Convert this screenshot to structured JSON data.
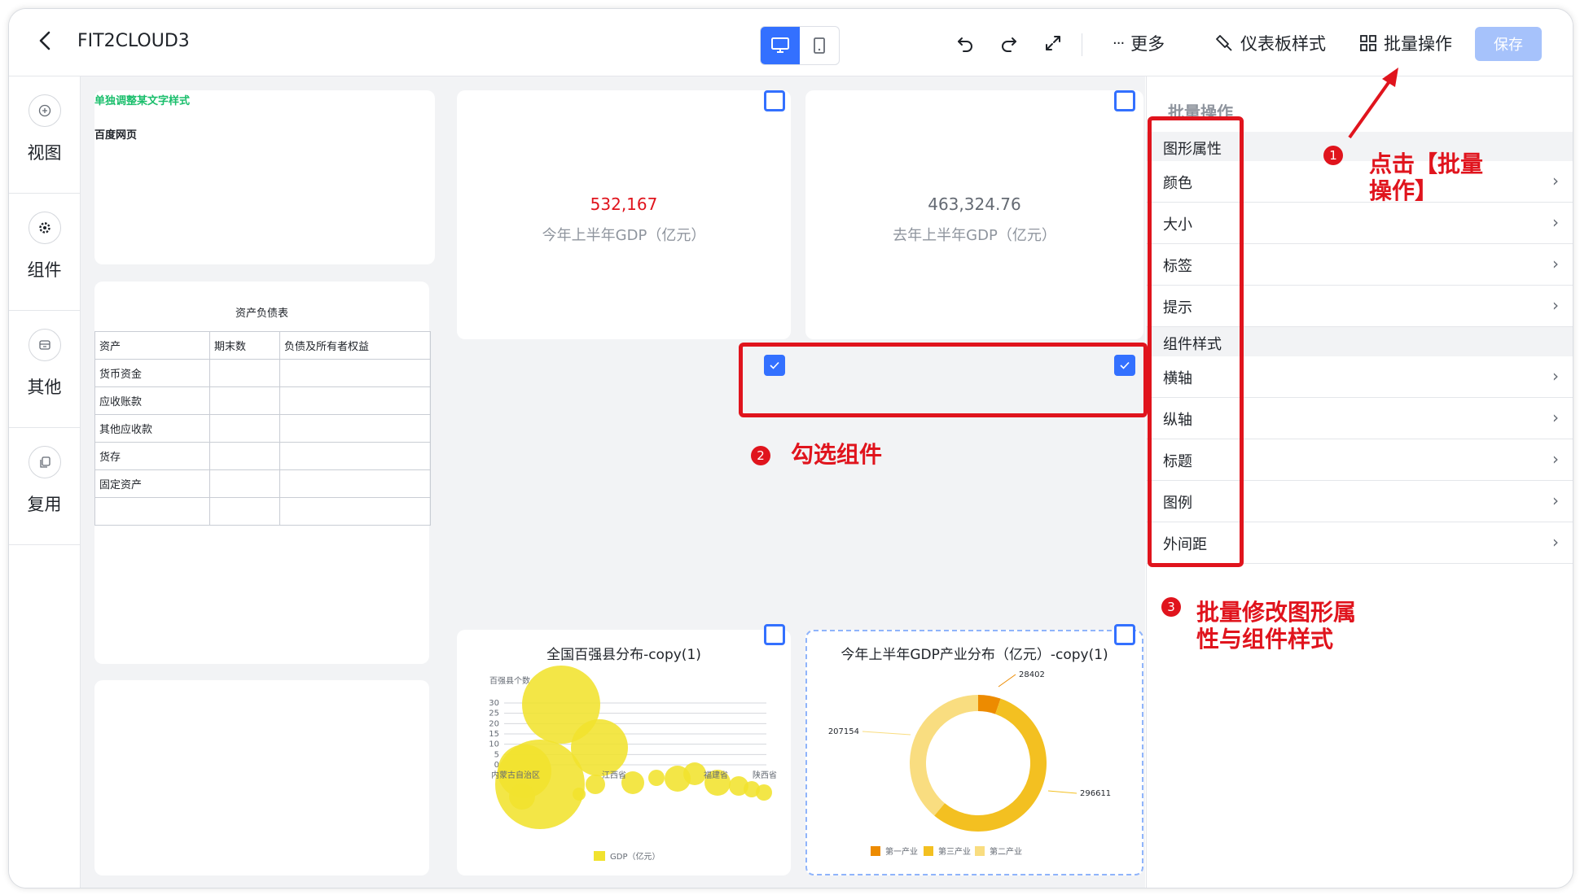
{
  "header": {
    "title": "FIT2CLOUD3",
    "more_label": "更多",
    "dashboard_style_label": "仪表板样式",
    "batch_label": "批量操作",
    "save_label": "保存"
  },
  "sidebar": {
    "items": [
      {
        "label": "视图"
      },
      {
        "label": "组件"
      },
      {
        "label": "其他"
      },
      {
        "label": "复用"
      }
    ]
  },
  "canvas": {
    "text_card": {
      "title": "单独调整某文字样式",
      "body": "百度网页"
    },
    "kpi1": {
      "value": "532,167",
      "label": "今年上半年GDP（亿元）"
    },
    "kpi2": {
      "value": "463,324.76",
      "label": "去年上半年GDP（亿元）"
    },
    "balance_sheet": {
      "title": "资产负债表",
      "headers": [
        "资产",
        "期末数",
        "负债及所有者权益"
      ],
      "rows": [
        "货币资金",
        "应收账款",
        "其他应收款",
        "货存",
        "固定资产",
        ""
      ]
    }
  },
  "chart_data": [
    {
      "type": "scatter",
      "title": "全国百强县分布-copy(1)",
      "ylabel": "百强县个数",
      "yticks": [
        "30",
        "25",
        "20",
        "15",
        "10",
        "5",
        "0"
      ],
      "ylim": [
        0,
        30
      ],
      "xticks": [
        "内蒙古自治区",
        "江西省",
        "福建省",
        "陕西省"
      ],
      "legend": [
        "GDP（亿元）"
      ],
      "color": "#f1e22e"
    },
    {
      "type": "pie",
      "title": "今年上半年GDP产业分布（亿元）-copy(1)",
      "slices": [
        {
          "name": "第一产业",
          "value": 28402,
          "color": "#ed8b00"
        },
        {
          "name": "第三产业",
          "value": 296611,
          "color": "#f3c021"
        },
        {
          "name": "第二产业",
          "value": 207154,
          "color": "#f9dd80"
        }
      ],
      "legend_position": "bottom"
    }
  ],
  "right_panel": {
    "title": "批量操作",
    "sections": [
      {
        "title": "图形属性",
        "items": [
          "颜色",
          "大小",
          "标签",
          "提示"
        ]
      },
      {
        "title": "组件样式",
        "items": [
          "横轴",
          "纵轴",
          "标题",
          "图例",
          "外间距"
        ]
      }
    ]
  },
  "annotations": {
    "step1_num": "1",
    "step1": "点击【批量操作】",
    "step2_num": "2",
    "step2": "勾选组件",
    "step3_num": "3",
    "step3": "批量修改图形属性与组件样式",
    "color": "#e0141d"
  },
  "colors": {
    "accent": "#3370ff",
    "kpi_value": "#e0141d",
    "text_title_green": "#19be6b"
  }
}
